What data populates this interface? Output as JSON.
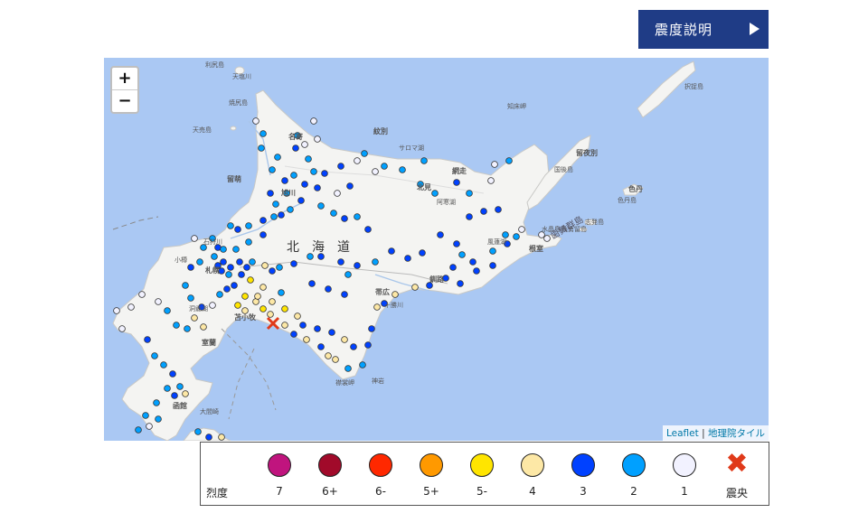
{
  "header": {
    "button_label": "震度説明"
  },
  "map": {
    "zoom_in": "+",
    "zoom_out": "−",
    "attribution": {
      "leaflet": "Leaflet",
      "sep": "|",
      "tiles": "地理院タイル"
    },
    "place_labels": [
      "利尻島",
      "天塩川",
      "焼尻島",
      "天売島",
      "名寄",
      "紋別",
      "サロマ湖",
      "網走",
      "留萌",
      "旭川",
      "北見",
      "阿寒湖",
      "北",
      "海",
      "道",
      "石狩川",
      "札幌",
      "小樽",
      "苫小牧",
      "室蘭",
      "洞爺湖",
      "帯広",
      "十勝川",
      "釧路",
      "根室",
      "風蓮湖",
      "水晶島",
      "秋勇留島",
      "志発島",
      "色丹島",
      "色丹",
      "択捉島",
      "国後島",
      "留夜別",
      "歯舞群島",
      "襟裳岬",
      "神岩",
      "函館",
      "大間崎",
      "知床岬"
    ],
    "colors": {
      "sea": "#aac8f3",
      "land": "#f4f4f2",
      "epicenter": "#e03a1a"
    }
  },
  "legend": {
    "title": "烈度",
    "items": [
      {
        "label": "7",
        "color": "#c0147e"
      },
      {
        "label": "6+",
        "color": "#a10a2a"
      },
      {
        "label": "6-",
        "color": "#ff2800"
      },
      {
        "label": "5+",
        "color": "#ff9900"
      },
      {
        "label": "5-",
        "color": "#ffe500"
      },
      {
        "label": "4",
        "color": "#fde8a6"
      },
      {
        "label": "3",
        "color": "#0041ff"
      },
      {
        "label": "2",
        "color": "#00a0ff"
      },
      {
        "label": "1",
        "color": "#f2f2ff"
      }
    ],
    "epicenter_label": "震央",
    "epicenter_icon": "x-mark-icon"
  }
}
